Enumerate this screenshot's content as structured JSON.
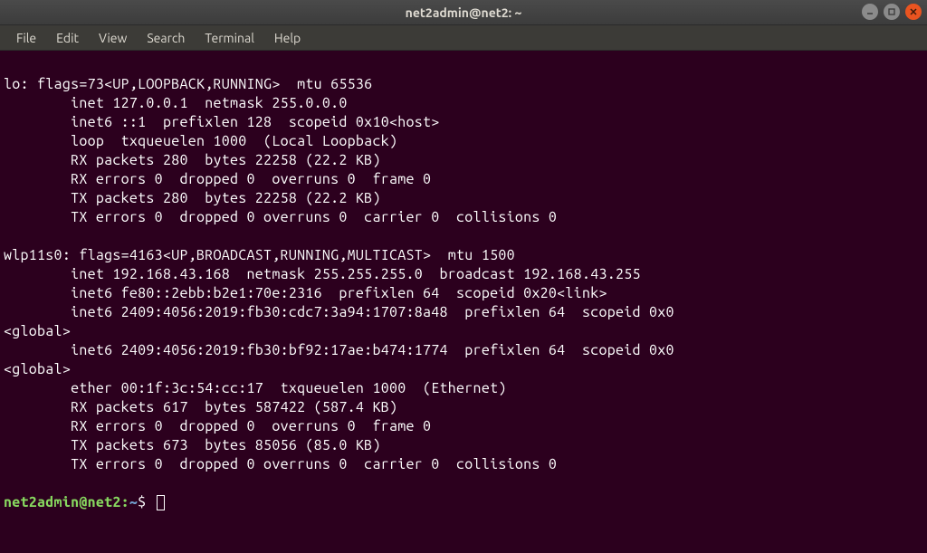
{
  "window": {
    "title": "net2admin@net2: ~"
  },
  "menu": {
    "file": "File",
    "edit": "Edit",
    "view": "View",
    "search": "Search",
    "terminal": "Terminal",
    "help": "Help"
  },
  "terminal": {
    "lines": [
      "",
      "lo: flags=73<UP,LOOPBACK,RUNNING>  mtu 65536",
      "        inet 127.0.0.1  netmask 255.0.0.0",
      "        inet6 ::1  prefixlen 128  scopeid 0x10<host>",
      "        loop  txqueuelen 1000  (Local Loopback)",
      "        RX packets 280  bytes 22258 (22.2 KB)",
      "        RX errors 0  dropped 0  overruns 0  frame 0",
      "        TX packets 280  bytes 22258 (22.2 KB)",
      "        TX errors 0  dropped 0 overruns 0  carrier 0  collisions 0",
      "",
      "wlp11s0: flags=4163<UP,BROADCAST,RUNNING,MULTICAST>  mtu 1500",
      "        inet 192.168.43.168  netmask 255.255.255.0  broadcast 192.168.43.255",
      "        inet6 fe80::2ebb:b2e1:70e:2316  prefixlen 64  scopeid 0x20<link>",
      "        inet6 2409:4056:2019:fb30:cdc7:3a94:1707:8a48  prefixlen 64  scopeid 0x0",
      "<global>",
      "        inet6 2409:4056:2019:fb30:bf92:17ae:b474:1774  prefixlen 64  scopeid 0x0",
      "<global>",
      "        ether 00:1f:3c:54:cc:17  txqueuelen 1000  (Ethernet)",
      "        RX packets 617  bytes 587422 (587.4 KB)",
      "        RX errors 0  dropped 0  overruns 0  frame 0",
      "        TX packets 673  bytes 85056 (85.0 KB)",
      "        TX errors 0  dropped 0 overruns 0  carrier 0  collisions 0",
      ""
    ],
    "prompt": {
      "userhost": "net2admin@net2",
      "colon": ":",
      "path": "~",
      "dollar": "$"
    }
  }
}
